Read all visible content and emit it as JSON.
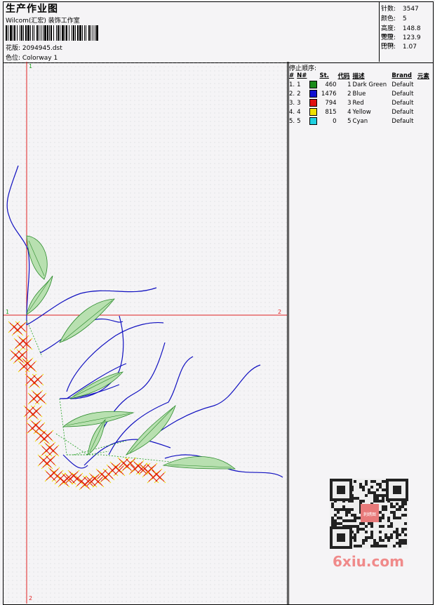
{
  "header": {
    "title": "生产作业图",
    "company": "Wilcom(汇宏) 装饰工作室",
    "design_label": "花版: 2094945.dst",
    "colorway_label": "色位: Colorway 1"
  },
  "stats": [
    {
      "key": "针数:",
      "value": "3547"
    },
    {
      "key": "颜色:",
      "value": "5"
    },
    {
      "key": "高度:",
      "value": "148.8 mm"
    },
    {
      "key": "宽度:",
      "value": "123.9 mm"
    },
    {
      "key": "比例:",
      "value": "1.07"
    }
  ],
  "stop_sequence": {
    "title": "停止顺序:",
    "columns": [
      "#",
      "N#",
      "St.",
      "代码",
      "描述",
      "Brand",
      "元素"
    ],
    "rows": [
      {
        "idx": "1.",
        "n": "1",
        "color": "#1a8a1a",
        "st": "460",
        "code": "1",
        "desc": "Dark Green",
        "brand": "Default"
      },
      {
        "idx": "2.",
        "n": "2",
        "color": "#1010d0",
        "st": "1476",
        "code": "2",
        "desc": "Blue",
        "brand": "Default"
      },
      {
        "idx": "3.",
        "n": "3",
        "color": "#e01010",
        "st": "794",
        "code": "3",
        "desc": "Red",
        "brand": "Default"
      },
      {
        "idx": "4.",
        "n": "4",
        "color": "#f0e000",
        "st": "815",
        "code": "4",
        "desc": "Yellow",
        "brand": "Default"
      },
      {
        "idx": "5.",
        "n": "5",
        "color": "#20d0e0",
        "st": "0",
        "code": "5",
        "desc": "Cyan",
        "brand": "Default"
      }
    ]
  },
  "axis_labels": {
    "v_top": "1",
    "v_bottom": "2",
    "h_left": "1",
    "h_right": "2"
  },
  "watermark": "6xiu.com",
  "qr_badge": "刺绣图"
}
